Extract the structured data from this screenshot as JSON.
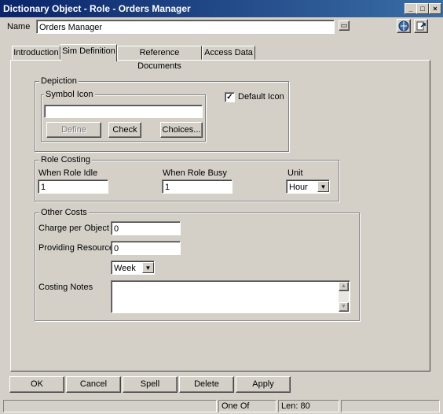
{
  "window": {
    "title": "Dictionary Object - Role - Orders Manager",
    "minimize_glyph": "_",
    "maximize_glyph": "□",
    "close_glyph": "×"
  },
  "name_row": {
    "label": "Name",
    "value": "Orders Manager"
  },
  "tabs": [
    {
      "label": "Introduction",
      "active": false
    },
    {
      "label": "Sim Definition",
      "active": true
    },
    {
      "label": "Reference Documents",
      "active": false
    },
    {
      "label": "Access Data",
      "active": false
    }
  ],
  "depiction": {
    "legend": "Depiction",
    "symbol_icon_legend": "Symbol Icon",
    "symbol_icon_value": "",
    "define_label": "Define",
    "check_label": "Check",
    "choices_label": "Choices...",
    "default_icon_label": "Default Icon",
    "default_icon_checked": true
  },
  "role_costing": {
    "legend": "Role Costing",
    "idle_label": "When Role Idle",
    "idle_value": "1",
    "busy_label": "When Role Busy",
    "busy_value": "1",
    "unit_label": "Unit",
    "unit_value": "Hour"
  },
  "other_costs": {
    "legend": "Other Costs",
    "charge_label": "Charge per Object",
    "charge_value": "0",
    "providing_label": "Providing Resource",
    "providing_value": "0",
    "period_value": "Week",
    "notes_label": "Costing Notes",
    "notes_value": ""
  },
  "buttons": {
    "ok": "OK",
    "cancel": "Cancel",
    "spell": "Spell",
    "delete": "Delete",
    "apply": "Apply"
  },
  "status": {
    "mode": "One Of",
    "length": "Len: 80"
  },
  "colors": {
    "title_start": "#0a246a",
    "title_end": "#3a6ea5",
    "face": "#d4d0c8"
  }
}
